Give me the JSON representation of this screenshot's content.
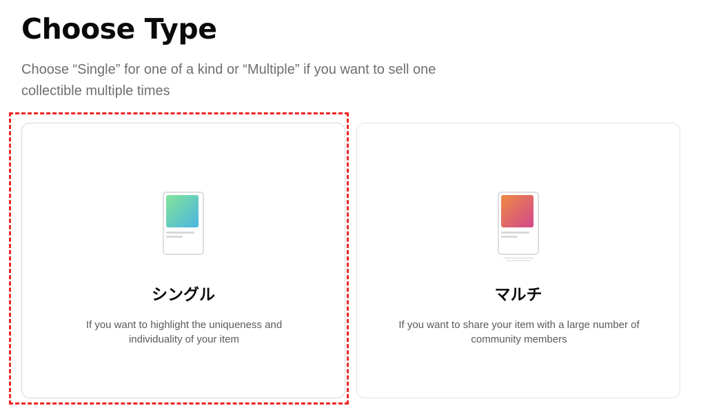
{
  "header": {
    "title": "Choose Type",
    "subtitle": "Choose “Single” for one of a kind or “Multiple” if you want to sell one collectible multiple times"
  },
  "cards": [
    {
      "id": "single",
      "title": "シングル",
      "description": "If you want to highlight the uniqueness and individuality of your item",
      "icon": "single-collectible-icon",
      "gradient": [
        "#84e39a",
        "#49b6e0"
      ],
      "selected": true
    },
    {
      "id": "multiple",
      "title": "マルチ",
      "description": "If you want to share your item with a large number of community members",
      "icon": "multiple-collectible-icon",
      "gradient": [
        "#ef8a44",
        "#d1478c"
      ],
      "selected": false
    }
  ],
  "colors": {
    "selection_outline": "#ec2424",
    "subtitle_text": "#6e6e6e",
    "card_border": "#d6d6d6"
  }
}
